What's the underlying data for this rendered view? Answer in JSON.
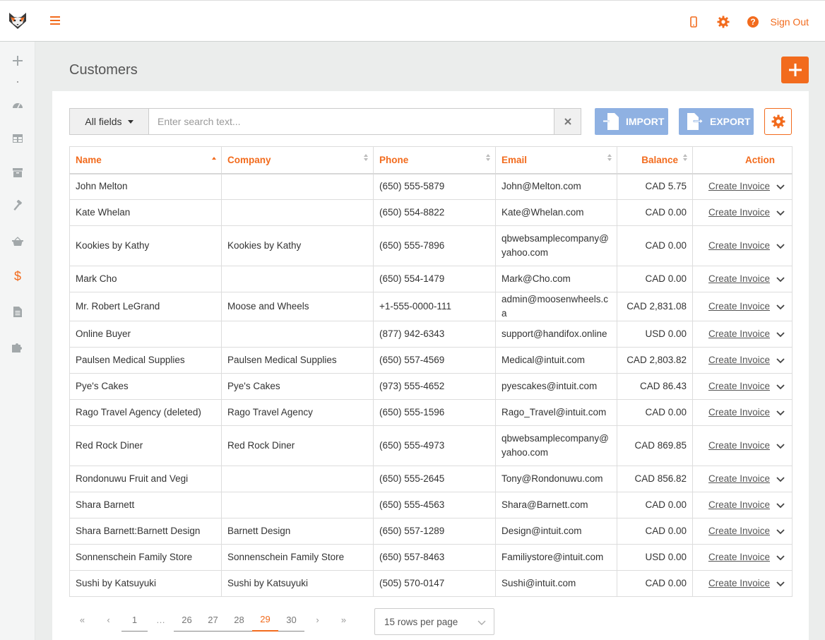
{
  "topbar": {
    "sign_out": "Sign Out"
  },
  "sidebar": {
    "items": [
      {
        "icon": "plus-icon"
      },
      {
        "icon": "dashboard-icon"
      },
      {
        "icon": "table-icon"
      },
      {
        "icon": "archive-icon"
      },
      {
        "icon": "hammer-icon"
      },
      {
        "icon": "basket-icon"
      },
      {
        "icon": "dollar-icon",
        "active": true
      },
      {
        "icon": "document-icon"
      },
      {
        "icon": "puzzle-icon"
      }
    ]
  },
  "page": {
    "title": "Customers"
  },
  "search": {
    "field": "All fields",
    "placeholder": "Enter search text..."
  },
  "toolbar": {
    "import_label": "IMPORT",
    "export_label": "EXPORT"
  },
  "table": {
    "columns": {
      "name": "Name",
      "company": "Company",
      "phone": "Phone",
      "email": "Email",
      "balance": "Balance",
      "action": "Action"
    },
    "action_label": "Create Invoice",
    "rows": [
      {
        "name": "John Melton",
        "company": "",
        "phone": "(650) 555-5879",
        "email": "John@Melton.com",
        "balance": "CAD 5.75"
      },
      {
        "name": "Kate Whelan",
        "company": "",
        "phone": "(650) 554-8822",
        "email": "Kate@Whelan.com",
        "balance": "CAD 0.00"
      },
      {
        "name": "Kookies by Kathy",
        "company": "Kookies by Kathy",
        "phone": "(650) 555-7896",
        "email": "qbwebsamplecompany@yahoo.com",
        "balance": "CAD 0.00"
      },
      {
        "name": "Mark Cho",
        "company": "",
        "phone": "(650) 554-1479",
        "email": "Mark@Cho.com",
        "balance": "CAD 0.00"
      },
      {
        "name": "Mr. Robert LeGrand",
        "company": "Moose and Wheels",
        "phone": "+1-555-0000-111",
        "email": "admin@moosenwheels.ca",
        "balance": "CAD 2,831.08"
      },
      {
        "name": "Online Buyer",
        "company": "",
        "phone": "(877) 942-6343",
        "email": "support@handifox.online",
        "balance": "USD 0.00"
      },
      {
        "name": "Paulsen Medical Supplies",
        "company": "Paulsen Medical Supplies",
        "phone": "(650) 557-4569",
        "email": "Medical@intuit.com",
        "balance": "CAD 2,803.82"
      },
      {
        "name": "Pye's Cakes",
        "company": "Pye's Cakes",
        "phone": "(973) 555-4652",
        "email": "pyescakes@intuit.com",
        "balance": "CAD 86.43"
      },
      {
        "name": "Rago Travel Agency (deleted)",
        "company": "Rago Travel Agency",
        "phone": "(650) 555-1596",
        "email": "Rago_Travel@intuit.com",
        "balance": "CAD 0.00"
      },
      {
        "name": "Red Rock Diner",
        "company": "Red Rock Diner",
        "phone": "(650) 555-4973",
        "email": "qbwebsamplecompany@yahoo.com",
        "balance": "CAD 869.85"
      },
      {
        "name": "Rondonuwu Fruit and Vegi",
        "company": "",
        "phone": "(650) 555-2645",
        "email": "Tony@Rondonuwu.com",
        "balance": "CAD 856.82"
      },
      {
        "name": "Shara Barnett",
        "company": "",
        "phone": "(650) 555-4563",
        "email": "Shara@Barnett.com",
        "balance": "CAD 0.00"
      },
      {
        "name": "Shara Barnett:Barnett Design",
        "company": "Barnett Design",
        "phone": "(650) 557-1289",
        "email": "Design@intuit.com",
        "balance": "CAD 0.00"
      },
      {
        "name": "Sonnenschein Family Store",
        "company": "Sonnenschein Family Store",
        "phone": "(650) 557-8463",
        "email": "Familiystore@intuit.com",
        "balance": "USD 0.00"
      },
      {
        "name": "Sushi by Katsuyuki",
        "company": "Sushi by Katsuyuki",
        "phone": "(505) 570-0147",
        "email": "Sushi@intuit.com",
        "balance": "CAD 0.00"
      }
    ]
  },
  "pagination": {
    "first": "«",
    "prev": "‹",
    "next": "›",
    "last": "»",
    "ellipsis": "…",
    "pages": [
      "1",
      "26",
      "27",
      "28",
      "29",
      "30"
    ],
    "current": "29",
    "rows_per_page": "15 rows per page"
  },
  "colors": {
    "accent": "#f26b1d",
    "button_blue": "#8fb1e2"
  }
}
